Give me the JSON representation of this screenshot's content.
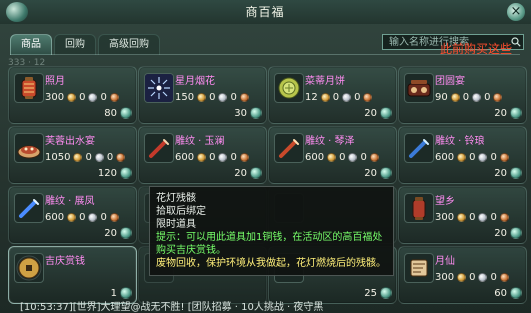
{
  "window": {
    "title": "商百福"
  },
  "tabs": [
    {
      "label": "商品",
      "active": true
    },
    {
      "label": "回购",
      "active": false
    },
    {
      "label": "高级回购",
      "active": false
    }
  ],
  "search": {
    "placeholder": "输入名称进行搜索"
  },
  "marquee": {
    "text": "此前购买这些"
  },
  "header_faint": {
    "text": "333 · 12"
  },
  "items": [
    {
      "name": "照月",
      "price_gold": "300",
      "price_silver": "0",
      "price_copper": "0",
      "stock": "80"
    },
    {
      "name": "星月烟花",
      "price_gold": "150",
      "price_silver": "0",
      "price_copper": "0",
      "stock": "30"
    },
    {
      "name": "菜蒂月饼",
      "price_gold": "12",
      "price_silver": "0",
      "price_copper": "0",
      "stock": "20"
    },
    {
      "name": "团圆宴",
      "price_gold": "90",
      "price_silver": "0",
      "price_copper": "0",
      "stock": "20"
    },
    {
      "name": "芙蓉出水宴",
      "price_gold": "1050",
      "price_silver": "0",
      "price_copper": "0",
      "stock": "120"
    },
    {
      "name": "雕纹 · 玉澜",
      "price_gold": "600",
      "price_silver": "0",
      "price_copper": "0",
      "stock": "20"
    },
    {
      "name": "雕纹 · 琴泽",
      "price_gold": "600",
      "price_silver": "0",
      "price_copper": "0",
      "stock": "20"
    },
    {
      "name": "雕纹 · 铃琅",
      "price_gold": "600",
      "price_silver": "0",
      "price_copper": "0",
      "stock": "20"
    },
    {
      "name": "雕纹 · 展凤",
      "price_gold": "600",
      "price_silver": "0",
      "price_copper": "0",
      "stock": "20"
    },
    {
      "name": "",
      "price_gold": "",
      "price_silver": "",
      "price_copper": "",
      "stock": ""
    },
    {
      "name": "",
      "price_gold": "",
      "price_silver": "",
      "price_copper": "",
      "stock": ""
    },
    {
      "name": "望乡",
      "price_gold": "300",
      "price_silver": "0",
      "price_copper": "0",
      "stock": "20"
    },
    {
      "name": "吉庆赏钱",
      "price_gold": "",
      "price_silver": "",
      "price_copper": "",
      "stock": "1"
    },
    {
      "name": "",
      "price_gold": "",
      "price_silver": "",
      "price_copper": "",
      "stock": ""
    },
    {
      "name": "",
      "price_gold": "",
      "price_silver": "",
      "price_copper": "",
      "stock": "25"
    },
    {
      "name": "月仙",
      "price_gold": "300",
      "price_silver": "0",
      "price_copper": "0",
      "stock": "60"
    }
  ],
  "tooltip": {
    "title": "花灯残骸",
    "line1": "拾取后绑定",
    "line2": "限时道具",
    "green": "提示：可以用此道具加1铜钱，在活动区的高百福处购买吉庆赏钱。",
    "yellow": "废物回收，保护环境从我做起，花灯燃烧后的残骸。"
  },
  "chat": {
    "text": "[10:53:37][世界]大理望@战无不胜!  [团队招募 · 10人挑战 · 夜守黑"
  },
  "colors": {
    "name_pink": "#ff8cf2",
    "warning_red": "#ff4d2d",
    "tip_green": "#77ff6a",
    "tip_yellow": "#fff07a"
  }
}
